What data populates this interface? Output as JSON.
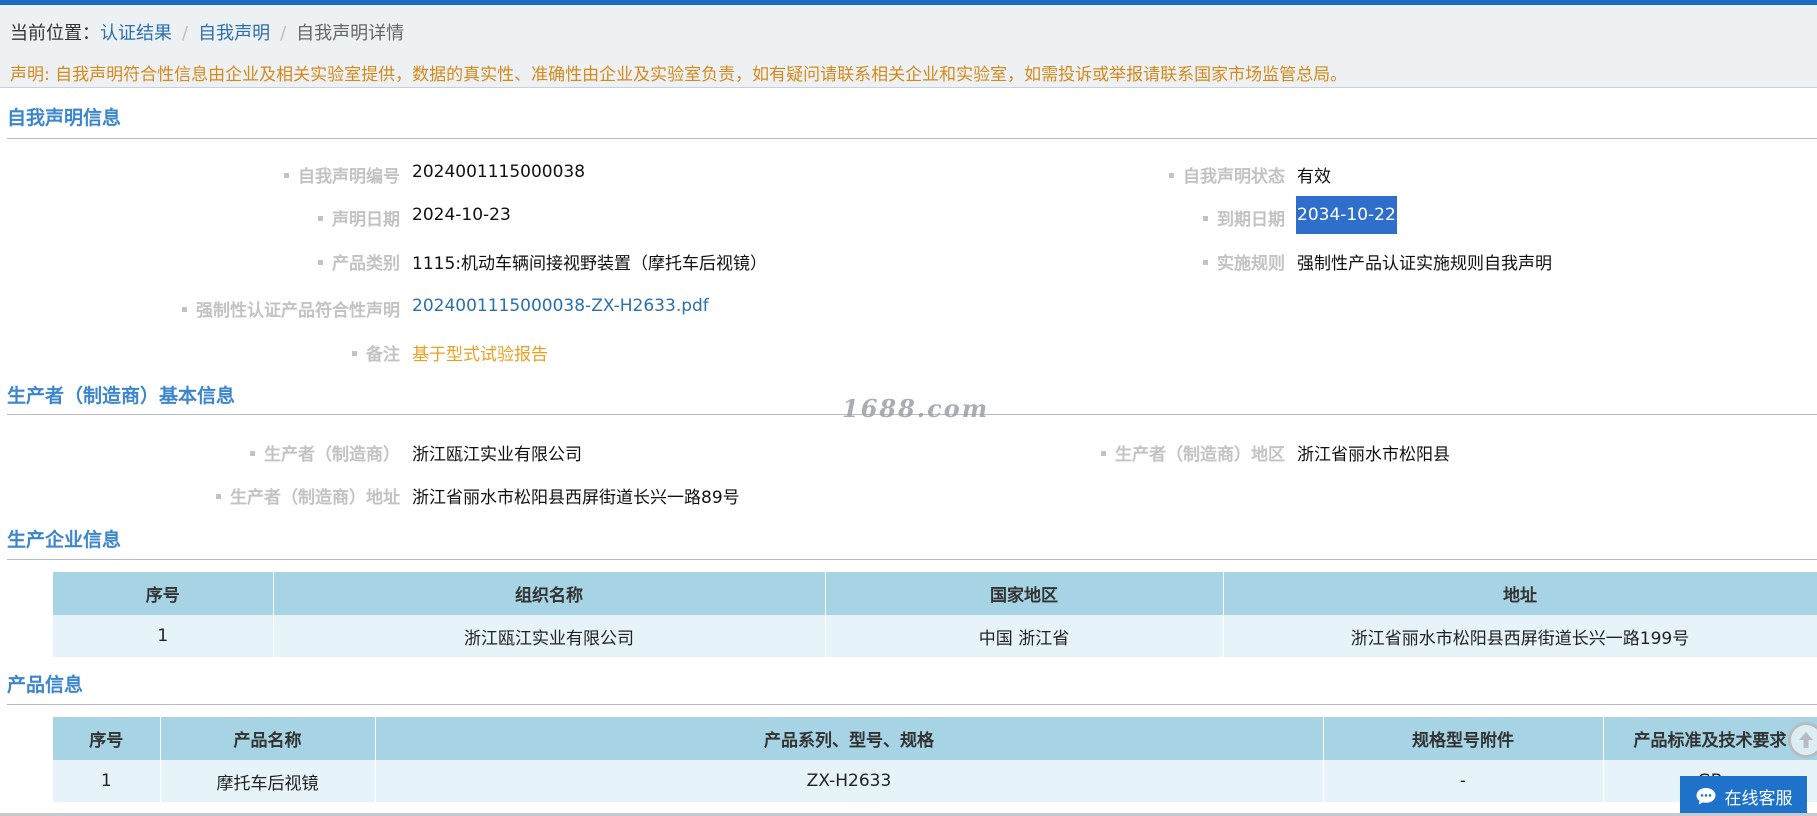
{
  "breadcrumb": {
    "prefix": "当前位置：",
    "items": [
      "认证结果",
      "自我声明",
      "自我声明详情"
    ],
    "separator": "/"
  },
  "notice": "声明: 自我声明符合性信息由企业及相关实验室提供，数据的真实性、准确性由企业及实验室负责，如有疑问请联系相关企业和实验室，如需投诉或举报请联系国家市场监管总局。",
  "sections": {
    "declaration": {
      "title": "自我声明信息",
      "fields": {
        "number_label": "自我声明编号",
        "number": "2024001115000038",
        "status_label": "自我声明状态",
        "status": "有效",
        "date_label": "声明日期",
        "date": "2024-10-23",
        "expiry_label": "到期日期",
        "expiry": "2034-10-22",
        "category_label": "产品类别",
        "category": "1115:机动车辆间接视野装置（摩托车后视镜）",
        "rule_label": "实施规则",
        "rule": "强制性产品认证实施规则自我声明",
        "conformity_label": "强制性认证产品符合性声明",
        "conformity_file": "2024001115000038-ZX-H2633.pdf",
        "remark_label": "备注",
        "remark": "基于型式试验报告"
      }
    },
    "producer": {
      "title": "生产者（制造商）基本信息",
      "fields": {
        "name_label": "生产者（制造商）",
        "name": "浙江瓯江实业有限公司",
        "region_label": "生产者（制造商）地区",
        "region": "浙江省丽水市松阳县",
        "address_label": "生产者（制造商）地址",
        "address": "浙江省丽水市松阳县西屏街道长兴一路89号"
      }
    },
    "enterprise": {
      "title": "生产企业信息",
      "columns": [
        "序号",
        "组织名称",
        "国家地区",
        "地址"
      ],
      "rows": [
        [
          "1",
          "浙江瓯江实业有限公司",
          "中国 浙江省",
          "浙江省丽水市松阳县西屏街道长兴一路199号"
        ]
      ]
    },
    "product": {
      "title": "产品信息",
      "columns": [
        "序号",
        "产品名称",
        "产品系列、型号、规格",
        "规格型号附件",
        "产品标准及技术要求"
      ],
      "rows": [
        [
          "1",
          "摩托车后视镜",
          "ZX-H2633",
          "-",
          "GB"
        ]
      ]
    }
  },
  "watermark": "1688.com",
  "service_button": "在线客服",
  "colors": {
    "top_bar": "#1b6fc2",
    "section_title": "#3b86cc",
    "link": "#2a6fb0",
    "notice": "#d48a1a",
    "highlight": "#2f6ecb",
    "table_header": "#a7d4e4",
    "table_row": "#e6f3f8"
  },
  "icons": {
    "scroll_top": "arrow-up-circle-icon",
    "service": "chat-bubble-icon"
  }
}
